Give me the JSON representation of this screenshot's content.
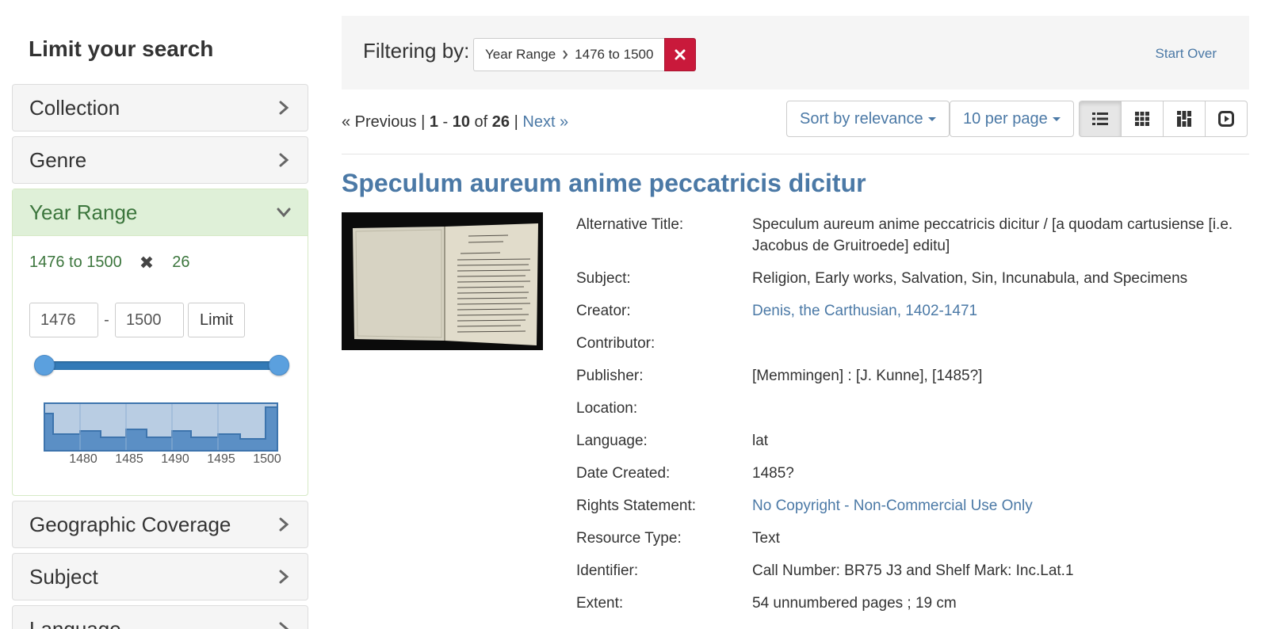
{
  "sidebar": {
    "heading": "Limit your search",
    "facets": {
      "collection": "Collection",
      "genre": "Genre",
      "year_range": "Year Range",
      "geographic_coverage": "Geographic Coverage",
      "subject": "Subject",
      "language": "Language"
    },
    "year_range": {
      "selected": "1476 to 1500",
      "count": "26",
      "begin": "1476",
      "end": "1500",
      "limit_label": "Limit",
      "slider_range": [
        1476,
        1500
      ],
      "histogram_labels": [
        "1480",
        "1485",
        "1490",
        "1495",
        "1500"
      ]
    }
  },
  "filter_bar": {
    "label": "Filtering by:",
    "constraint_field": "Year Range",
    "constraint_value": "1476 to 1500",
    "start_over": "Start Over"
  },
  "pager": {
    "previous": "« Previous",
    "start": "1",
    "end": "10",
    "of_word": "of",
    "total": "26",
    "next": "Next »"
  },
  "sort": {
    "label": "Sort by relevance"
  },
  "per_page": {
    "label": "10 per page"
  },
  "view_modes": [
    "list-icon",
    "gallery-icon",
    "masonry-icon",
    "slideshow-icon"
  ],
  "result": {
    "title": "Speculum aureum anime peccatricis dicitur",
    "fields": [
      {
        "label": "Alternative Title:",
        "value": "Speculum aureum anime peccatricis dicitur / [a quodam cartusiense [i.e. Jacobus de Gruitroede] editu]"
      },
      {
        "label": "Subject:",
        "value": "Religion, Early works, Salvation, Sin, Incunabula, and Specimens"
      },
      {
        "label": "Creator:",
        "value": "Denis, the Carthusian, 1402-1471"
      },
      {
        "label": "Contributor:",
        "value": ""
      },
      {
        "label": "Publisher:",
        "value": "[Memmingen] : [J. Kunne], [1485?]"
      },
      {
        "label": "Location:",
        "value": ""
      },
      {
        "label": "Language:",
        "value": "lat"
      },
      {
        "label": "Date Created:",
        "value": "1485?"
      },
      {
        "label": "Rights Statement:",
        "value": "No Copyright - Non-Commercial Use Only"
      },
      {
        "label": "Resource Type:",
        "value": "Text"
      },
      {
        "label": "Identifier:",
        "value": "Call Number: BR75 J3 and Shelf Mark: Inc.Lat.1"
      },
      {
        "label": "Extent:",
        "value": "54 unnumbered pages ; 19 cm"
      }
    ]
  },
  "colors": {
    "link": "#4b79a6",
    "active_facet_bg": "#dff0d8",
    "active_facet_text": "#3c763d",
    "remove_button": "#c9193b",
    "slider": "#337ab7"
  }
}
